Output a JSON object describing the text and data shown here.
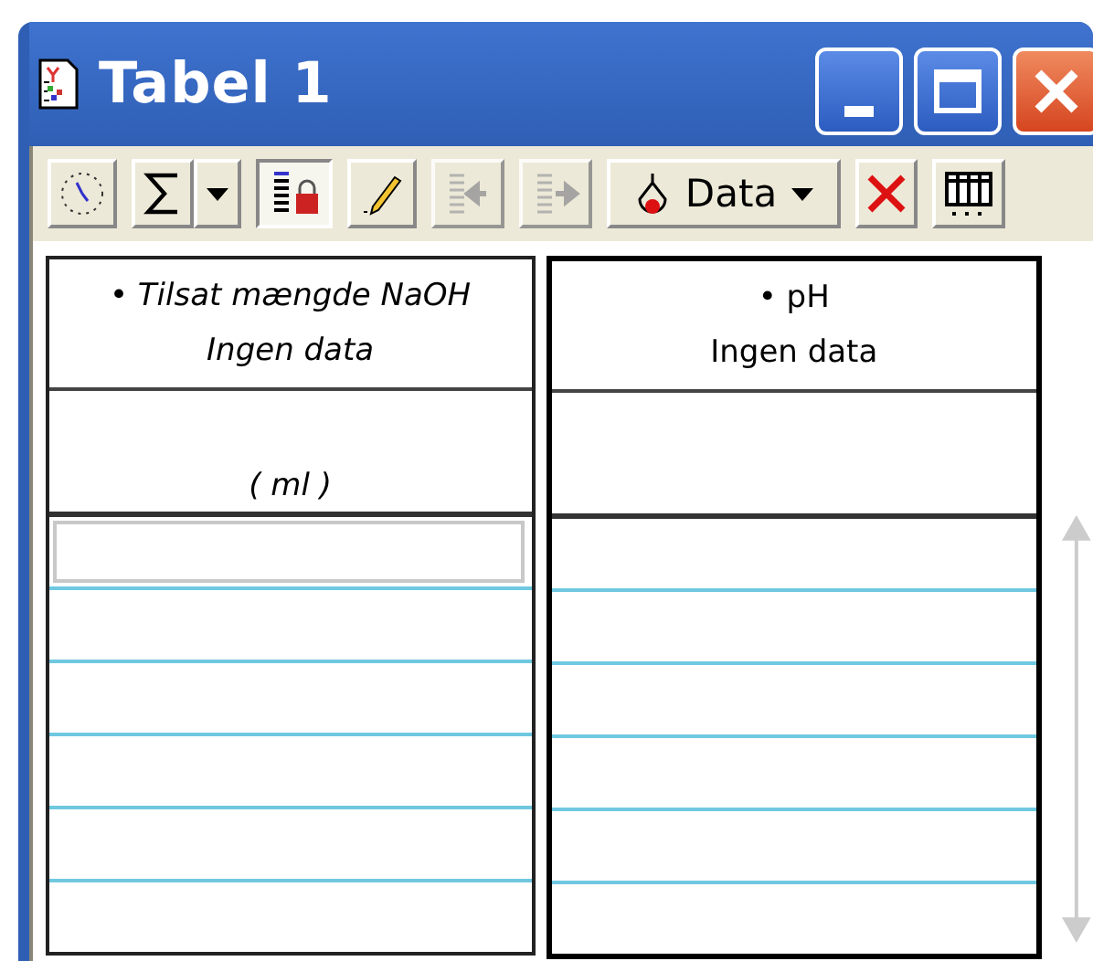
{
  "window": {
    "title": "Tabel 1"
  },
  "toolbar": [
    {
      "kind": "clock",
      "pressed": false,
      "disabled": false
    },
    {
      "kind": "sigma",
      "pressed": false,
      "disabled": false
    },
    {
      "kind": "caret",
      "pressed": false,
      "disabled": false
    },
    {
      "kind": "lock",
      "pressed": true,
      "disabled": false
    },
    {
      "kind": "pencil",
      "pressed": false,
      "disabled": false
    },
    {
      "kind": "import",
      "pressed": false,
      "disabled": true
    },
    {
      "kind": "export",
      "pressed": false,
      "disabled": true
    },
    {
      "kind": "data",
      "label": "Data",
      "pressed": false,
      "disabled": false
    },
    {
      "kind": "delete",
      "pressed": false,
      "disabled": false
    },
    {
      "kind": "columns",
      "pressed": false,
      "disabled": false
    }
  ],
  "columns": [
    {
      "bullet": "•",
      "name": "Tilsat mængde NaOH",
      "status": "Ingen data",
      "unit": "( ml )",
      "italic": true,
      "selected": false,
      "editing": true
    },
    {
      "bullet": "•",
      "name": "pH",
      "status": "Ingen data",
      "italic": false,
      "selected": true,
      "editing": false
    }
  ]
}
